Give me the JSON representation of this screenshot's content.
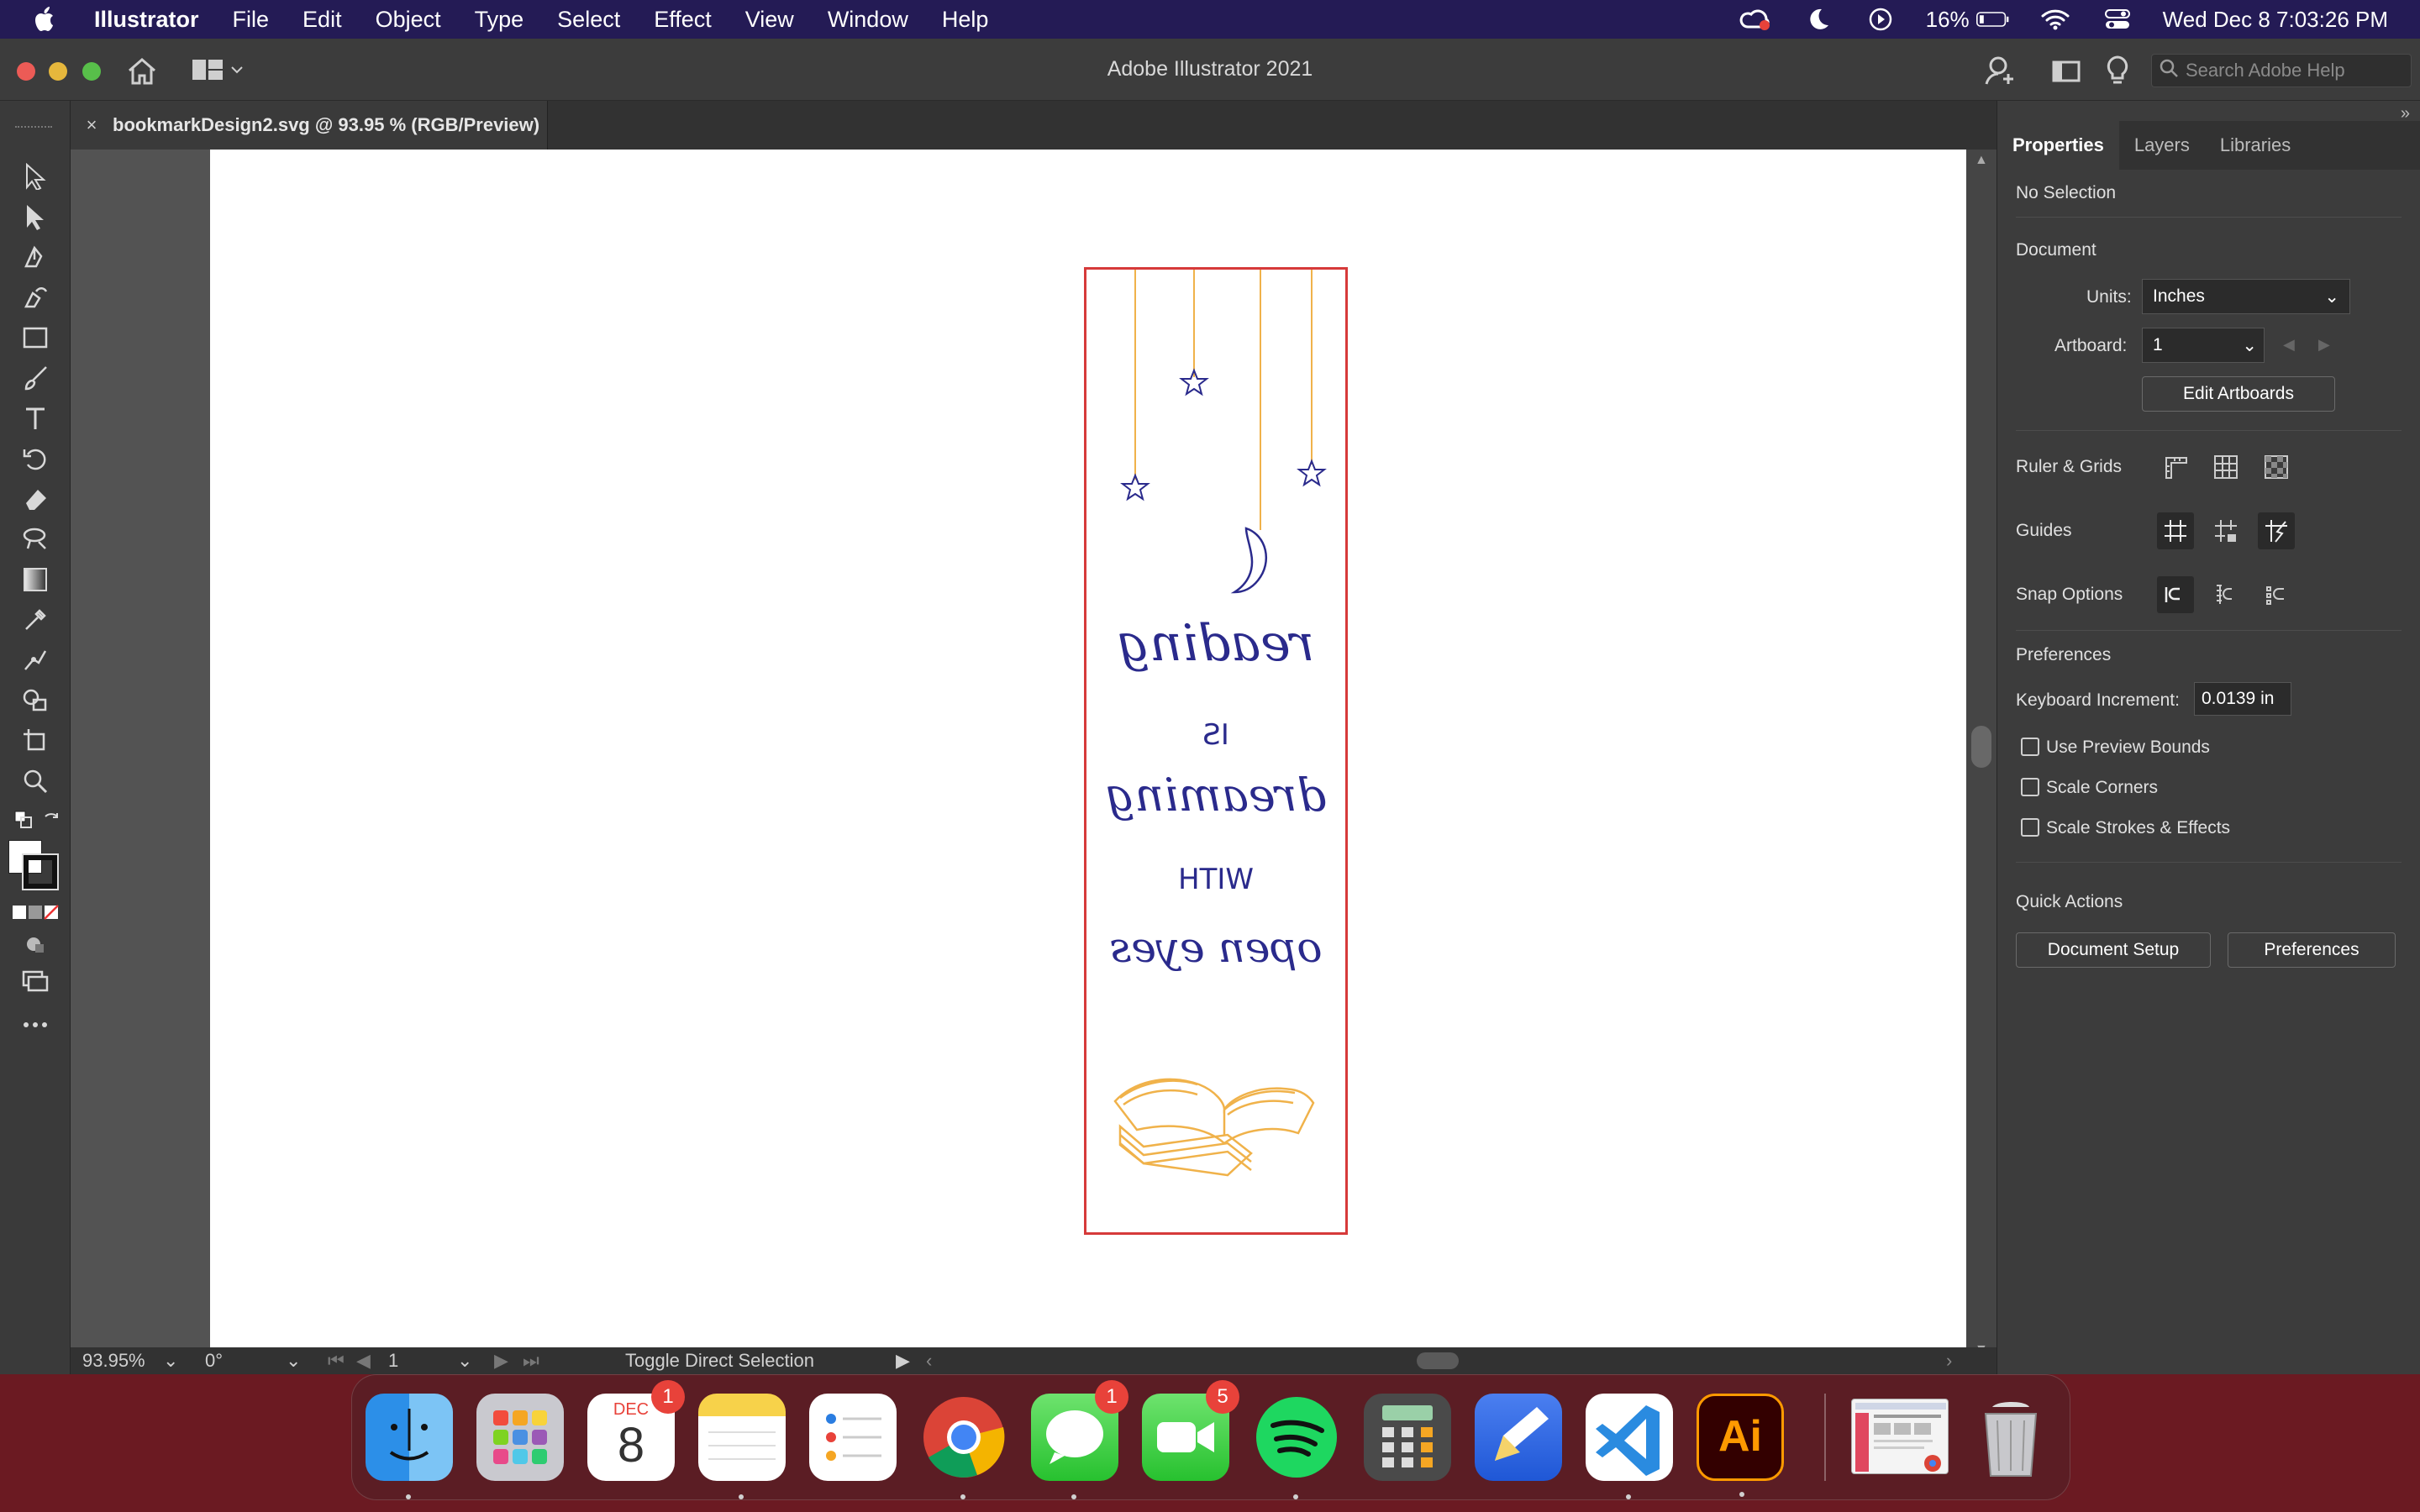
{
  "menubar": {
    "app_name": "Illustrator",
    "items": [
      "File",
      "Edit",
      "Object",
      "Type",
      "Select",
      "Effect",
      "View",
      "Window",
      "Help"
    ],
    "battery": "16%",
    "datetime": "Wed Dec 8  7:03:26 PM"
  },
  "window": {
    "title": "Adobe Illustrator 2021",
    "search_placeholder": "Search Adobe Help"
  },
  "document_tab": {
    "close": "×",
    "label": "bookmarkDesign2.svg @ 93.95 % (RGB/Preview)"
  },
  "bookmark": {
    "line1": "reading",
    "line2": "IS",
    "line3": "dreaming",
    "line4": "WITH",
    "line5": "open eyes",
    "text_color": "#2a2a8c",
    "accent_color": "#f0b24a",
    "border_color": "#d63a3a"
  },
  "statusbar": {
    "zoom": "93.95%",
    "rotation": "0°",
    "artboard": "1",
    "tool_hint": "Toggle Direct Selection"
  },
  "panel": {
    "tabs": [
      "Properties",
      "Layers",
      "Libraries"
    ],
    "selection": "No Selection",
    "document_heading": "Document",
    "units_label": "Units:",
    "units_value": "Inches",
    "artboard_label": "Artboard:",
    "artboard_value": "1",
    "edit_artboards": "Edit Artboards",
    "ruler_grids": "Ruler & Grids",
    "guides": "Guides",
    "snap_options": "Snap Options",
    "preferences_heading": "Preferences",
    "keyboard_increment_label": "Keyboard Increment:",
    "keyboard_increment_value": "0.0139 in",
    "checkboxes": [
      "Use Preview Bounds",
      "Scale Corners",
      "Scale Strokes & Effects"
    ],
    "quick_actions": "Quick Actions",
    "document_setup": "Document Setup",
    "preferences_button": "Preferences"
  },
  "dock": {
    "calendar_month": "DEC",
    "calendar_day": "8",
    "calendar_badge": "1",
    "messages_badge": "1",
    "facetime_badge": "5",
    "illustrator_label": "Ai"
  }
}
